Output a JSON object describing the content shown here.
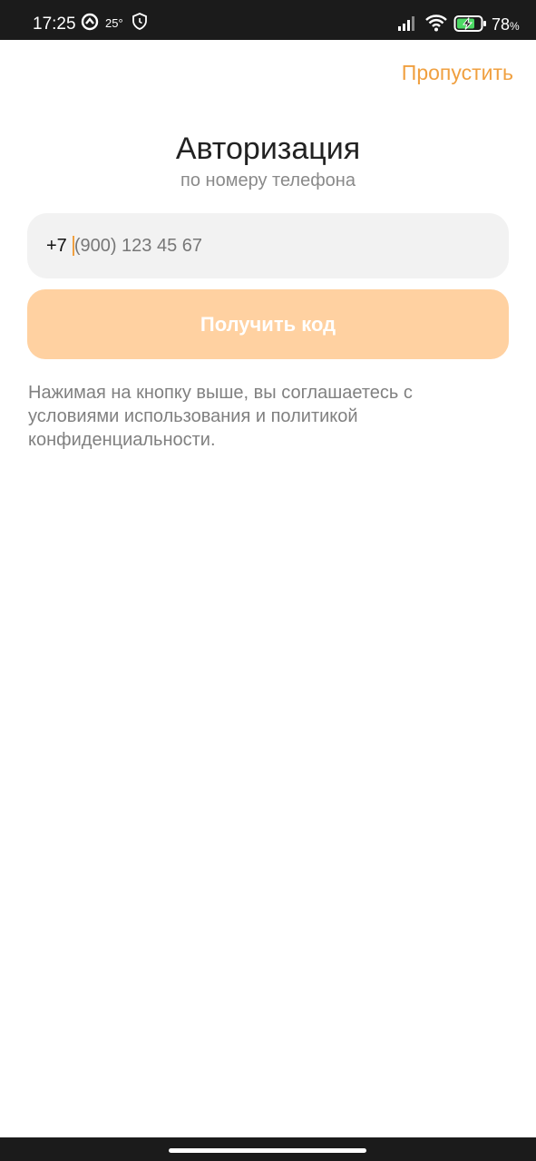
{
  "status_bar": {
    "time": "17:25",
    "temperature": "25°",
    "battery_percent": "78",
    "battery_unit": "%",
    "icons": [
      "app-icon",
      "shield-icon",
      "signal-icon",
      "wifi-icon",
      "battery-charging-icon"
    ]
  },
  "header": {
    "skip_label": "Пропустить"
  },
  "main": {
    "title": "Авторизация",
    "subtitle": "по номеру телефона",
    "phone_prefix": "+7",
    "phone_placeholder": "(900) 123 45 67",
    "submit_label": "Получить код",
    "consent_text": "Нажимая на кнопку выше, вы соглашаетесь с условиями использования и политикой конфиденциальности."
  },
  "colors": {
    "accent": "#f0a040",
    "button_disabled_bg": "#ffd1a1",
    "input_bg": "#f2f2f2",
    "status_bar_bg": "#1b1b1b"
  }
}
